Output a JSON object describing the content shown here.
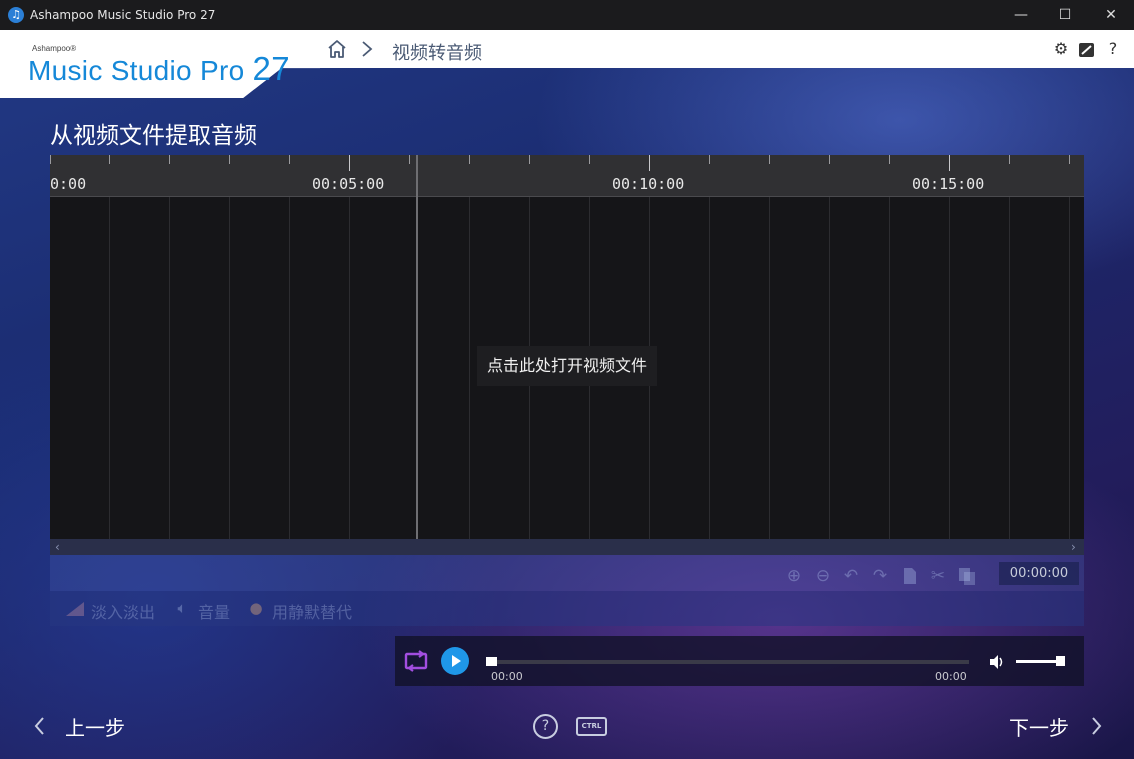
{
  "window": {
    "title": "Ashampoo Music Studio Pro 27",
    "minimize": "—",
    "maximize": "☐",
    "close": "✕"
  },
  "logo": {
    "small": "Ashampoo®",
    "name": "Music Studio Pro",
    "version": "27"
  },
  "breadcrumb": {
    "current": "视频转音频"
  },
  "header_icons": [
    "gear-icon",
    "edit-icon",
    "help-icon"
  ],
  "header_help": "?",
  "page": {
    "title": "从视频文件提取音频"
  },
  "timeline": {
    "labels": [
      "0:00",
      "00:05:00",
      "00:10:00",
      "00:15:00"
    ],
    "open_file": "点击此处打开视频文件"
  },
  "scrollbar": {
    "left": "‹",
    "right": "›"
  },
  "edit_toolbar": {
    "icons": [
      "zoom-in-icon",
      "zoom-out-icon",
      "undo-icon",
      "redo-icon",
      "copy-icon",
      "cut-icon",
      "paste-icon"
    ],
    "timecode": "00:00:00"
  },
  "actions": {
    "fade": "淡入淡出",
    "volume": "音量",
    "silence": "用静默替代"
  },
  "player": {
    "position": "00:00",
    "duration": "00:00",
    "progress": 0,
    "volume": 0.95
  },
  "nav": {
    "back": "上一步",
    "next": "下一步",
    "help": "?",
    "ctrl": "CTRL"
  },
  "colors": {
    "accent": "#1f97e8",
    "loop": "#a24ee0",
    "logo": "#1588d8"
  }
}
